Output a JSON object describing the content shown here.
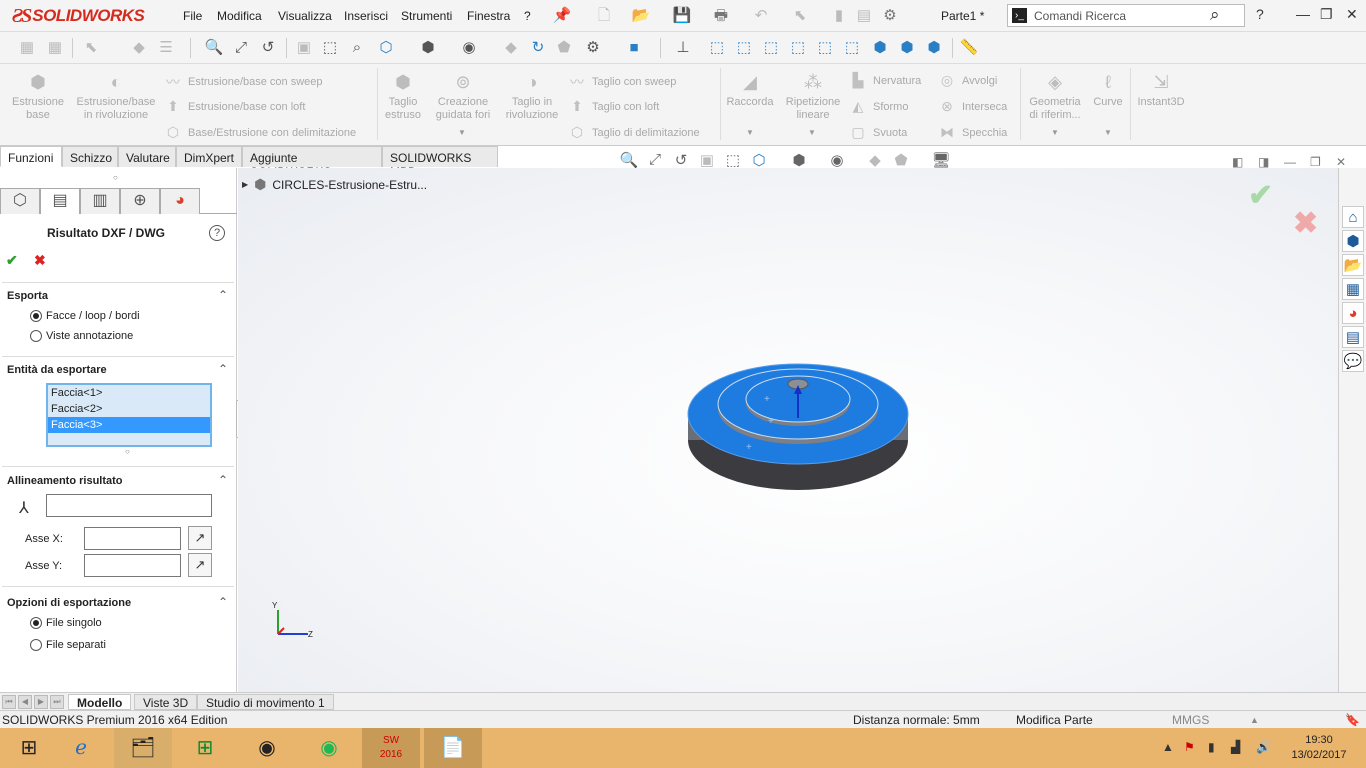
{
  "app": {
    "brand": "SOLIDWORKS",
    "doc_title": "Parte1 *"
  },
  "menu": [
    "File",
    "Modifica",
    "Visualizza",
    "Inserisci",
    "Strumenti",
    "Finestra",
    "?"
  ],
  "search": {
    "placeholder": "Comandi Ricerca"
  },
  "ribbon": {
    "estrusione_base": "Estrusione base",
    "estrusione_rivoluzione": "Estrusione/base in rivoluzione",
    "estrusione_sweep": "Estrusione/base con sweep",
    "estrusione_loft": "Estrusione/base con loft",
    "estrusione_delimitazione": "Base/Estrusione con delimitazione",
    "taglio_estruso": "Taglio estruso",
    "creazione_fori": "Creazione guidata fori",
    "taglio_rivoluzione": "Taglio in rivoluzione",
    "taglio_sweep": "Taglio con sweep",
    "taglio_loft": "Taglio con loft",
    "taglio_delimitazione": "Taglio di delimitazione",
    "raccorda": "Raccorda",
    "ripetizione_lineare": "Ripetizione lineare",
    "nervatura": "Nervatura",
    "sformo": "Sformo",
    "svuota": "Svuota",
    "avvolgi": "Avvolgi",
    "interseca": "Interseca",
    "specchia": "Specchia",
    "geometria_riferimento": "Geometria di riferim...",
    "curve": "Curve",
    "instant3d": "Instant3D"
  },
  "command_tabs": [
    "Funzioni",
    "Schizzo",
    "Valutare",
    "DimXpert",
    "Aggiunte SOLIDWORKS",
    "SOLIDWORKS MBD"
  ],
  "property_manager": {
    "title": "Risultato DXF / DWG",
    "export_group": "Esporta",
    "export_options": [
      "Facce / loop / bordi",
      "Viste annotazione"
    ],
    "entities_group": "Entità da esportare",
    "faces": [
      "Faccia<1>",
      "Faccia<2>",
      "Faccia<3>"
    ],
    "align_group": "Allineamento risultato",
    "axis_x_label": "Asse X:",
    "axis_y_label": "Asse Y:",
    "export_options_group": "Opzioni di esportazione",
    "file_options": [
      "File singolo",
      "File separati"
    ]
  },
  "tree": {
    "part_name": "CIRCLES-Estrusione-Estru..."
  },
  "bottom_tabs": [
    "Modello",
    "Viste 3D",
    "Studio di movimento 1"
  ],
  "status": {
    "edition": "SOLIDWORKS Premium 2016 x64 Edition",
    "distance": "Distanza normale: 5mm",
    "mode": "Modifica Parte",
    "units": "MMGS"
  },
  "taskbar": {
    "time": "19:30",
    "date": "13/02/2017",
    "sw_label": "2016"
  },
  "triad": {
    "y": "Y",
    "z": "Z"
  },
  "colors": {
    "accent_red": "#d52b1e",
    "face_blue": "#1e7be0",
    "select_blue": "#3399ff"
  }
}
